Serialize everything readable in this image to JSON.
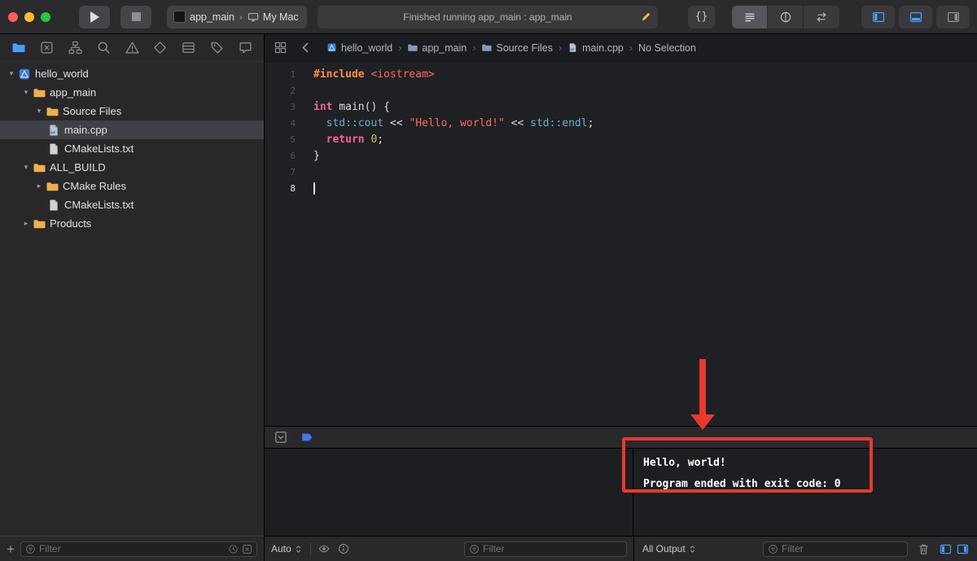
{
  "colors": {
    "accent_blue": "#4a9eff",
    "annotation_red": "#e8392e",
    "folder_yellow": "#efaf4c",
    "keyword_pink": "#fc5fa3",
    "preprocessor_orange": "#fd8f3f",
    "string_red": "#fc6a5d",
    "number_yellow": "#d0bf69",
    "type_teal": "#5fb3ce"
  },
  "titlebar": {
    "scheme_app": "app_main",
    "scheme_separator": "›",
    "scheme_target": "My Mac",
    "status_text": "Finished running app_main : app_main",
    "library_button": "{}",
    "editor_mode_buttons": [
      {
        "name": "editor-list-icon",
        "glyph": "editorlist",
        "active": true
      },
      {
        "name": "editor-circle-icon",
        "glyph": "editorcircle",
        "active": false
      },
      {
        "name": "editor-arrows-icon",
        "glyph": "editorarrows",
        "active": false
      }
    ],
    "panel_toggles": [
      {
        "name": "toggle-navigator-icon",
        "glyph": "panelleft",
        "active": true
      },
      {
        "name": "toggle-debug-area-icon",
        "glyph": "panelbottom",
        "active": true
      },
      {
        "name": "toggle-inspectors-icon",
        "glyph": "panelright",
        "active": false
      }
    ]
  },
  "navigator": {
    "icons": [
      {
        "name": "project-navigator-icon",
        "glyph": "folder",
        "active": true
      },
      {
        "name": "source-control-navigator-icon",
        "glyph": "xsquare",
        "active": false
      },
      {
        "name": "symbol-navigator-icon",
        "glyph": "orgchart",
        "active": false
      },
      {
        "name": "find-navigator-icon",
        "glyph": "search",
        "active": false
      },
      {
        "name": "issue-navigator-icon",
        "glyph": "warning",
        "active": false
      },
      {
        "name": "test-navigator-icon",
        "glyph": "diamond",
        "active": false
      },
      {
        "name": "debug-navigator-icon",
        "glyph": "rows",
        "active": false
      },
      {
        "name": "breakpoint-navigator-icon",
        "glyph": "tag",
        "active": false
      },
      {
        "name": "report-navigator-icon",
        "glyph": "bubble",
        "active": false
      }
    ],
    "tree": [
      {
        "label": "hello_world",
        "icon": "project",
        "indent": 6,
        "disclosure": "open",
        "selected": false
      },
      {
        "label": "app_main",
        "icon": "folder",
        "indent": 24,
        "disclosure": "open",
        "selected": false
      },
      {
        "label": "Source Files",
        "icon": "folder",
        "indent": 40,
        "disclosure": "open",
        "selected": false
      },
      {
        "label": "main.cpp",
        "icon": "cpp",
        "indent": 58,
        "disclosure": "none",
        "selected": true
      },
      {
        "label": "CMakeLists.txt",
        "icon": "doc",
        "indent": 58,
        "disclosure": "none",
        "selected": false
      },
      {
        "label": "ALL_BUILD",
        "icon": "folder",
        "indent": 24,
        "disclosure": "open",
        "selected": false
      },
      {
        "label": "CMake Rules",
        "icon": "folder",
        "indent": 40,
        "disclosure": "closed",
        "selected": false
      },
      {
        "label": "CMakeLists.txt",
        "icon": "doc",
        "indent": 58,
        "disclosure": "none",
        "selected": false
      },
      {
        "label": "Products",
        "icon": "folder",
        "indent": 24,
        "disclosure": "closed",
        "selected": false
      }
    ],
    "add_button": "+",
    "filter_placeholder": "Filter"
  },
  "jumpbar": {
    "crumbs": [
      {
        "label": "hello_world",
        "icon": "project"
      },
      {
        "label": "app_main",
        "icon": "folder"
      },
      {
        "label": "Source Files",
        "icon": "folder"
      },
      {
        "label": "main.cpp",
        "icon": "cpp"
      },
      {
        "label": "No Selection",
        "icon": null
      }
    ]
  },
  "editor": {
    "lines": [
      {
        "n": "1",
        "segs": [
          [
            "pre",
            "#include "
          ],
          [
            "str",
            "<iostream>"
          ]
        ]
      },
      {
        "n": "2",
        "segs": []
      },
      {
        "n": "3",
        "segs": [
          [
            "kw",
            "int"
          ],
          [
            "pl",
            " main() {"
          ]
        ]
      },
      {
        "n": "4",
        "segs": [
          [
            "pl",
            "  "
          ],
          [
            "typ",
            "std::cout"
          ],
          [
            "pl",
            " << "
          ],
          [
            "str",
            "\"Hello, world!\""
          ],
          [
            "pl",
            " << "
          ],
          [
            "typ",
            "std::endl"
          ],
          [
            "pl",
            ";"
          ]
        ]
      },
      {
        "n": "5",
        "segs": [
          [
            "pl",
            "  "
          ],
          [
            "kw",
            "return"
          ],
          [
            "pl",
            " "
          ],
          [
            "num",
            "0"
          ],
          [
            "pl",
            ";"
          ]
        ]
      },
      {
        "n": "6",
        "segs": [
          [
            "pl",
            "}"
          ]
        ]
      },
      {
        "n": "7",
        "segs": []
      },
      {
        "n": "8",
        "segs": [],
        "cursor": true,
        "current": true
      }
    ]
  },
  "debug": {
    "auto_label": "Auto",
    "filter_placeholder": "Filter"
  },
  "console": {
    "lines": [
      "Hello, world!",
      "Program ended with exit code: 0"
    ],
    "all_output_label": "All Output",
    "filter_placeholder": "Filter"
  }
}
